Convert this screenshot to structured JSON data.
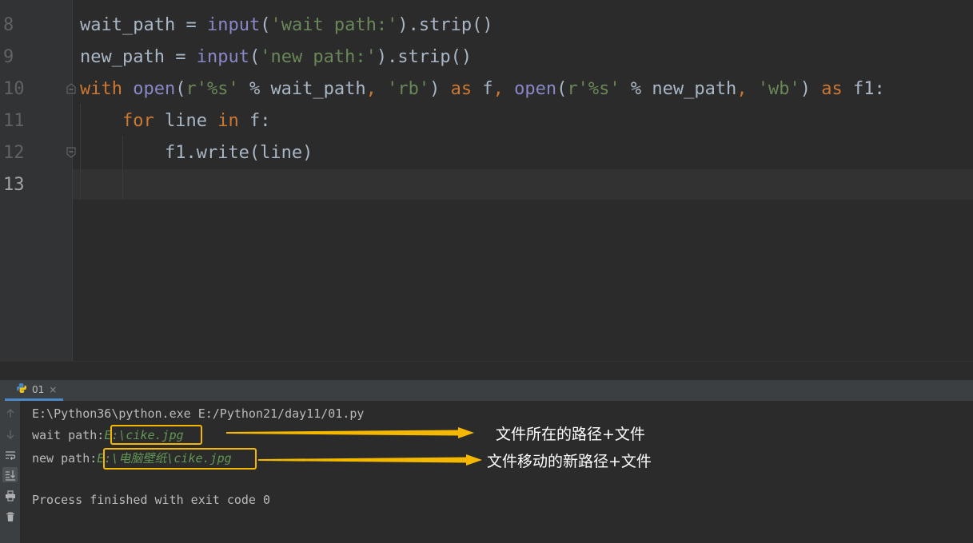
{
  "editor": {
    "line_numbers": [
      "8",
      "9",
      "10",
      "11",
      "12",
      "13"
    ],
    "lines": [
      [
        {
          "t": "wait_path",
          "c": "plain"
        },
        {
          "t": " = ",
          "c": "plain"
        },
        {
          "t": "input",
          "c": "bi"
        },
        {
          "t": "(",
          "c": "plain"
        },
        {
          "t": "'wait path:'",
          "c": "str"
        },
        {
          "t": ").strip()",
          "c": "plain"
        }
      ],
      [
        {
          "t": "new_path",
          "c": "plain"
        },
        {
          "t": " = ",
          "c": "plain"
        },
        {
          "t": "input",
          "c": "bi"
        },
        {
          "t": "(",
          "c": "plain"
        },
        {
          "t": "'new path:'",
          "c": "str"
        },
        {
          "t": ").strip()",
          "c": "plain"
        }
      ],
      [
        {
          "t": "with",
          "c": "kw"
        },
        {
          "t": " ",
          "c": "plain"
        },
        {
          "t": "open",
          "c": "bi"
        },
        {
          "t": "(",
          "c": "plain"
        },
        {
          "t": "r'%s'",
          "c": "str"
        },
        {
          "t": " % wait_path",
          "c": "plain"
        },
        {
          "t": ",",
          "c": "punc"
        },
        {
          "t": " ",
          "c": "plain"
        },
        {
          "t": "'rb'",
          "c": "str"
        },
        {
          "t": ") ",
          "c": "plain"
        },
        {
          "t": "as",
          "c": "kw"
        },
        {
          "t": " f",
          "c": "plain"
        },
        {
          "t": ",",
          "c": "punc"
        },
        {
          "t": " ",
          "c": "plain"
        },
        {
          "t": "open",
          "c": "bi"
        },
        {
          "t": "(",
          "c": "plain"
        },
        {
          "t": "r'%s'",
          "c": "str"
        },
        {
          "t": " % new_path",
          "c": "plain"
        },
        {
          "t": ",",
          "c": "punc"
        },
        {
          "t": " ",
          "c": "plain"
        },
        {
          "t": "'wb'",
          "c": "str"
        },
        {
          "t": ") ",
          "c": "plain"
        },
        {
          "t": "as",
          "c": "kw"
        },
        {
          "t": " f1:",
          "c": "plain"
        }
      ],
      [
        {
          "t": "    ",
          "c": "plain"
        },
        {
          "t": "for",
          "c": "kw"
        },
        {
          "t": " line ",
          "c": "plain"
        },
        {
          "t": "in",
          "c": "kw"
        },
        {
          "t": " f:",
          "c": "plain"
        }
      ],
      [
        {
          "t": "        f1.write(line)",
          "c": "plain"
        }
      ],
      []
    ]
  },
  "run_panel": {
    "tab_label": "01",
    "tab_close": "×"
  },
  "console": {
    "command": "E:\\Python36\\python.exe E:/Python21/day11/01.py",
    "wait_prompt": "wait path:",
    "wait_input": "E:\\cike.jpg",
    "new_prompt": "new path:",
    "new_input": "E:\\电脑壁纸\\cike.jpg",
    "finished": "Process finished with exit code 0"
  },
  "annotations": {
    "first": "文件所在的路径+文件",
    "second": "文件移动的新路径+文件"
  },
  "colors": {
    "highlight": "#f5b800",
    "keyword": "#cc7832",
    "builtin": "#8888c6",
    "string": "#6a8759",
    "console_input": "#629755"
  },
  "icons": [
    "python-file-icon",
    "arrow-up-icon",
    "arrow-down-icon",
    "soft-wrap-icon",
    "scroll-to-end-icon",
    "print-icon",
    "trash-icon"
  ]
}
